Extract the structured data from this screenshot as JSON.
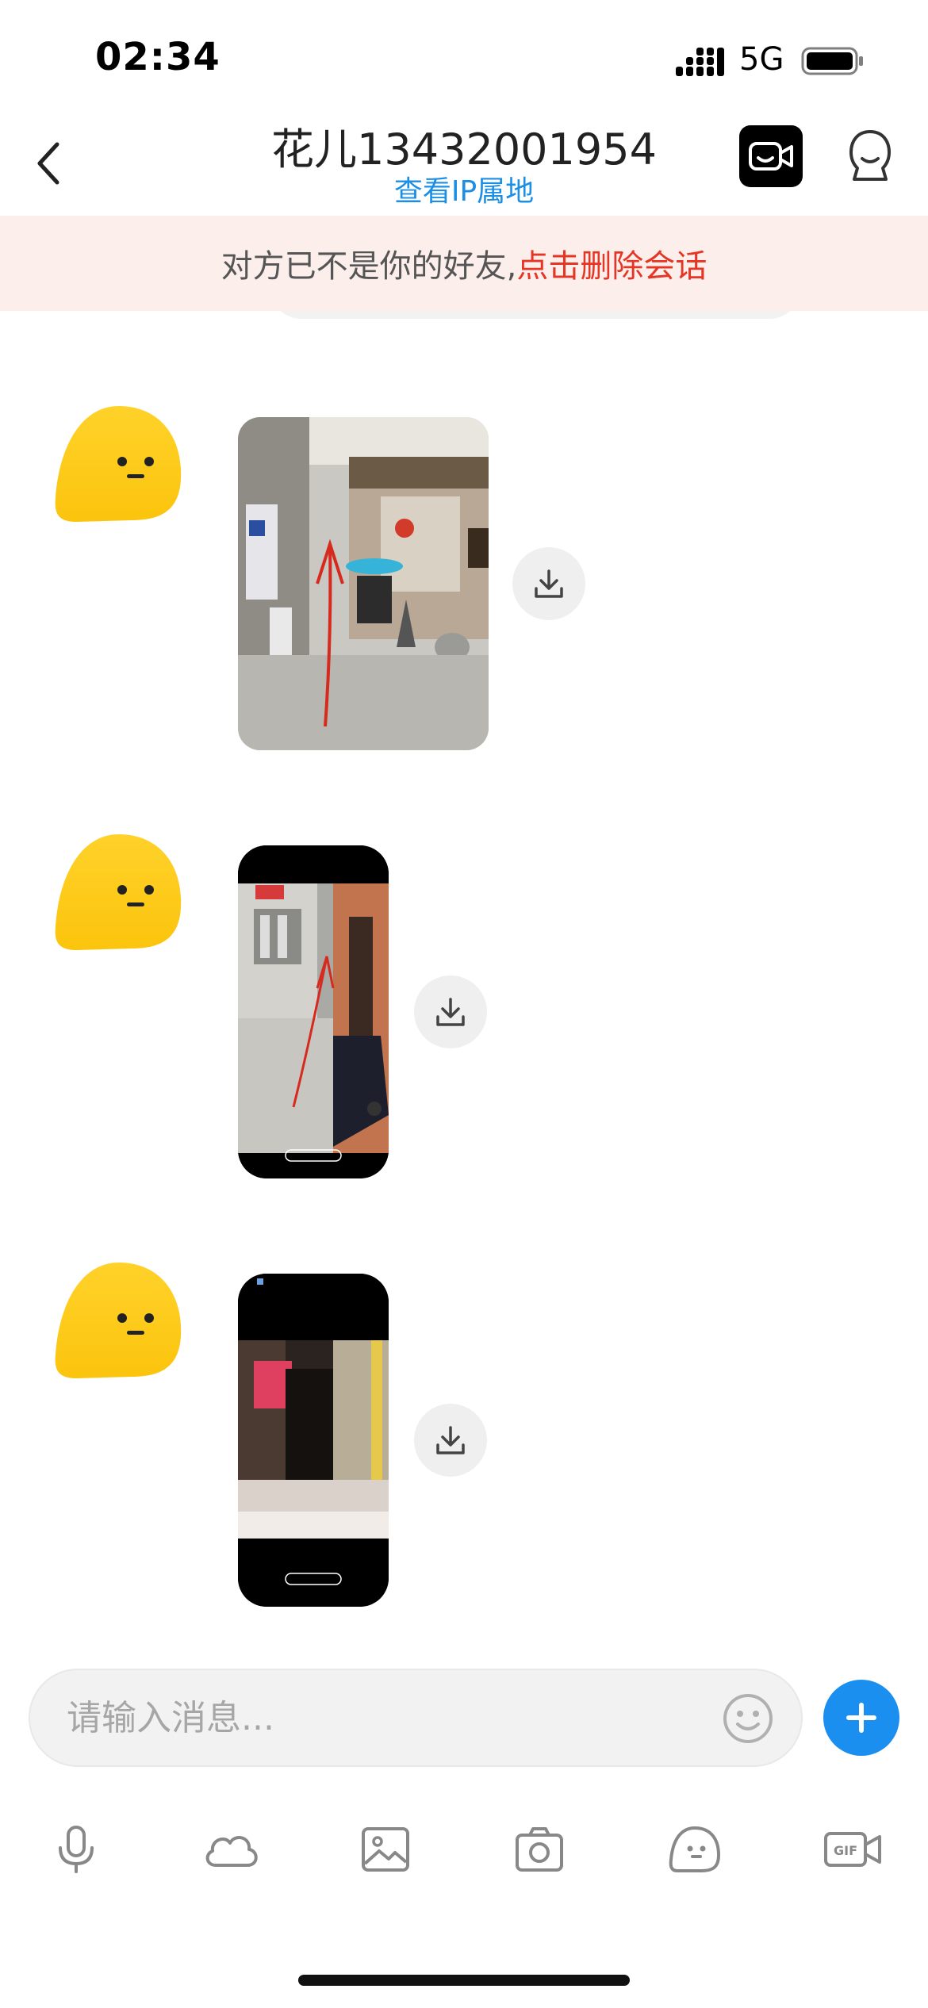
{
  "status_bar": {
    "time": "02:34",
    "network": "5G"
  },
  "nav": {
    "title": "花儿13432001954",
    "subtitle": "查看IP属地"
  },
  "banner": {
    "text": "对方已不是你的好友, ",
    "link": "点击删除会话"
  },
  "input": {
    "placeholder": "请输入消息..."
  },
  "colors": {
    "accent_blue": "#1a8ff0",
    "banner_bg": "#fbeeeb",
    "banner_link": "#e53525",
    "avatar_yellow": "#ffcd1a"
  },
  "messages": [
    {
      "sender": "avatar",
      "type": "image",
      "content": "street photo with red arrow"
    },
    {
      "sender": "avatar",
      "type": "image",
      "content": "alley screenshot with red arrow"
    },
    {
      "sender": "avatar",
      "type": "image",
      "content": "doorway screenshot"
    }
  ],
  "toolbar": {
    "icons": [
      "microphone-icon",
      "cloud-icon",
      "image-icon",
      "camera-icon",
      "sticker-face-icon",
      "gif-icon"
    ]
  }
}
